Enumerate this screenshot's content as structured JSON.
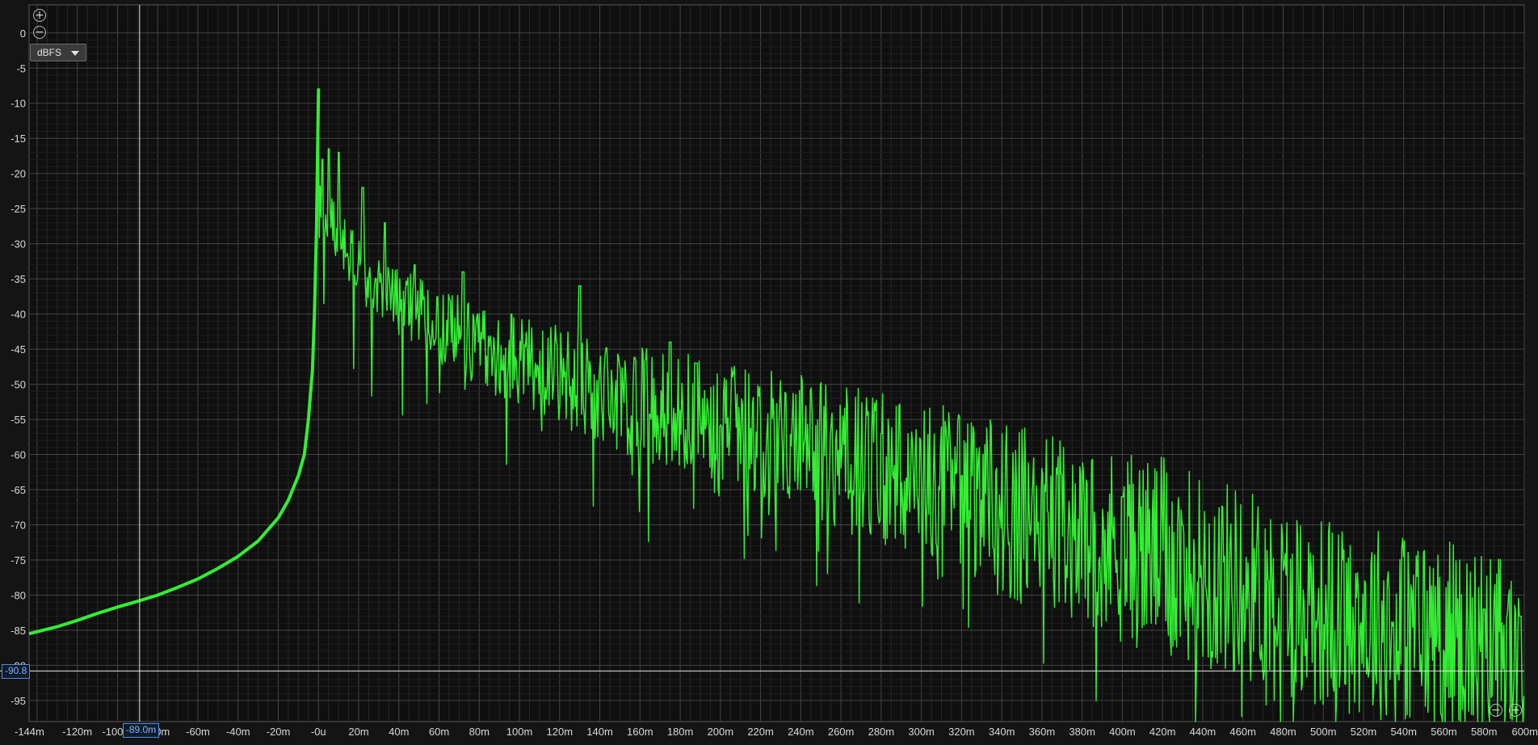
{
  "chart_data": {
    "type": "line",
    "y_unit": "dBFS",
    "xlim": [
      -144,
      600
    ],
    "ylim": [
      -98,
      4
    ],
    "x_ticks": [
      "-144m",
      "-120m",
      "-100",
      "0m",
      "-60m",
      "-40m",
      "-20m",
      "-0u",
      "20m",
      "40m",
      "60m",
      "80m",
      "100m",
      "120m",
      "140m",
      "160m",
      "180m",
      "200m",
      "220m",
      "240m",
      "260m",
      "280m",
      "300m",
      "320m",
      "340m",
      "360m",
      "380m",
      "400m",
      "420m",
      "440m",
      "460m",
      "480m",
      "500m",
      "520m",
      "540m",
      "560m",
      "580m",
      "600m"
    ],
    "y_ticks": [
      "0",
      "-5",
      "-10",
      "-15",
      "-20",
      "-25",
      "-30",
      "-35",
      "-40",
      "-45",
      "-50",
      "-55",
      "-60",
      "-65",
      "-70",
      "-75",
      "-80",
      "-85",
      "-90",
      "-95"
    ],
    "series_color": "#33ee33",
    "pre_impulse": {
      "x": [
        -144,
        -130,
        -120,
        -110,
        -100,
        -89,
        -80,
        -70,
        -60,
        -50,
        -40,
        -30,
        -20,
        -15,
        -10,
        -7,
        -5,
        -3,
        -2,
        -1
      ],
      "y": [
        -85.5,
        -84.5,
        -83.6,
        -82.6,
        -81.7,
        -80.8,
        -80.0,
        -78.9,
        -77.7,
        -76.2,
        -74.5,
        -72.3,
        -69.0,
        -66.5,
        -63.0,
        -60.0,
        -55.0,
        -48.0,
        -40.0,
        -28.0
      ]
    },
    "peak": {
      "x": 0,
      "y": -8.0
    },
    "decay_envelope": {
      "x": [
        2,
        20,
        40,
        60,
        80,
        100,
        120,
        140,
        160,
        180,
        200,
        220,
        240,
        260,
        280,
        300,
        320,
        340,
        360,
        380,
        400,
        420,
        440,
        460,
        480,
        500,
        520,
        540,
        560,
        580,
        600
      ],
      "y": [
        -25,
        -33,
        -38,
        -41,
        -44,
        -46,
        -48,
        -51,
        -52,
        -53,
        -55,
        -56,
        -57,
        -59,
        -61,
        -63,
        -64,
        -67,
        -68,
        -70,
        -72,
        -73,
        -75,
        -77,
        -79,
        -81,
        -82,
        -83,
        -84,
        -86,
        -87
      ]
    },
    "decay_spikes": [
      {
        "x": 2,
        "y": -18
      },
      {
        "x": 5,
        "y": -16.5
      },
      {
        "x": 10,
        "y": -17
      },
      {
        "x": 22,
        "y": -22
      },
      {
        "x": 33,
        "y": -27
      },
      {
        "x": 48,
        "y": -33
      },
      {
        "x": 72,
        "y": -34
      },
      {
        "x": 96,
        "y": -40
      },
      {
        "x": 130,
        "y": -36
      },
      {
        "x": 175,
        "y": -44
      },
      {
        "x": 188,
        "y": -47
      },
      {
        "x": 280,
        "y": -57
      },
      {
        "x": 320,
        "y": -63
      },
      {
        "x": 400,
        "y": -66
      },
      {
        "x": 430,
        "y": -70
      },
      {
        "x": 580,
        "y": -82
      },
      {
        "x": 598,
        "y": -83
      }
    ],
    "cursor": {
      "x": -89,
      "y": -90.8
    }
  },
  "ui": {
    "unit_selector": {
      "selected": "dBFS"
    },
    "cursor_x_label": "-89.0m",
    "cursor_y_label": "-90.8",
    "zoom_in_symbol": "+",
    "zoom_out_symbol": "−"
  }
}
